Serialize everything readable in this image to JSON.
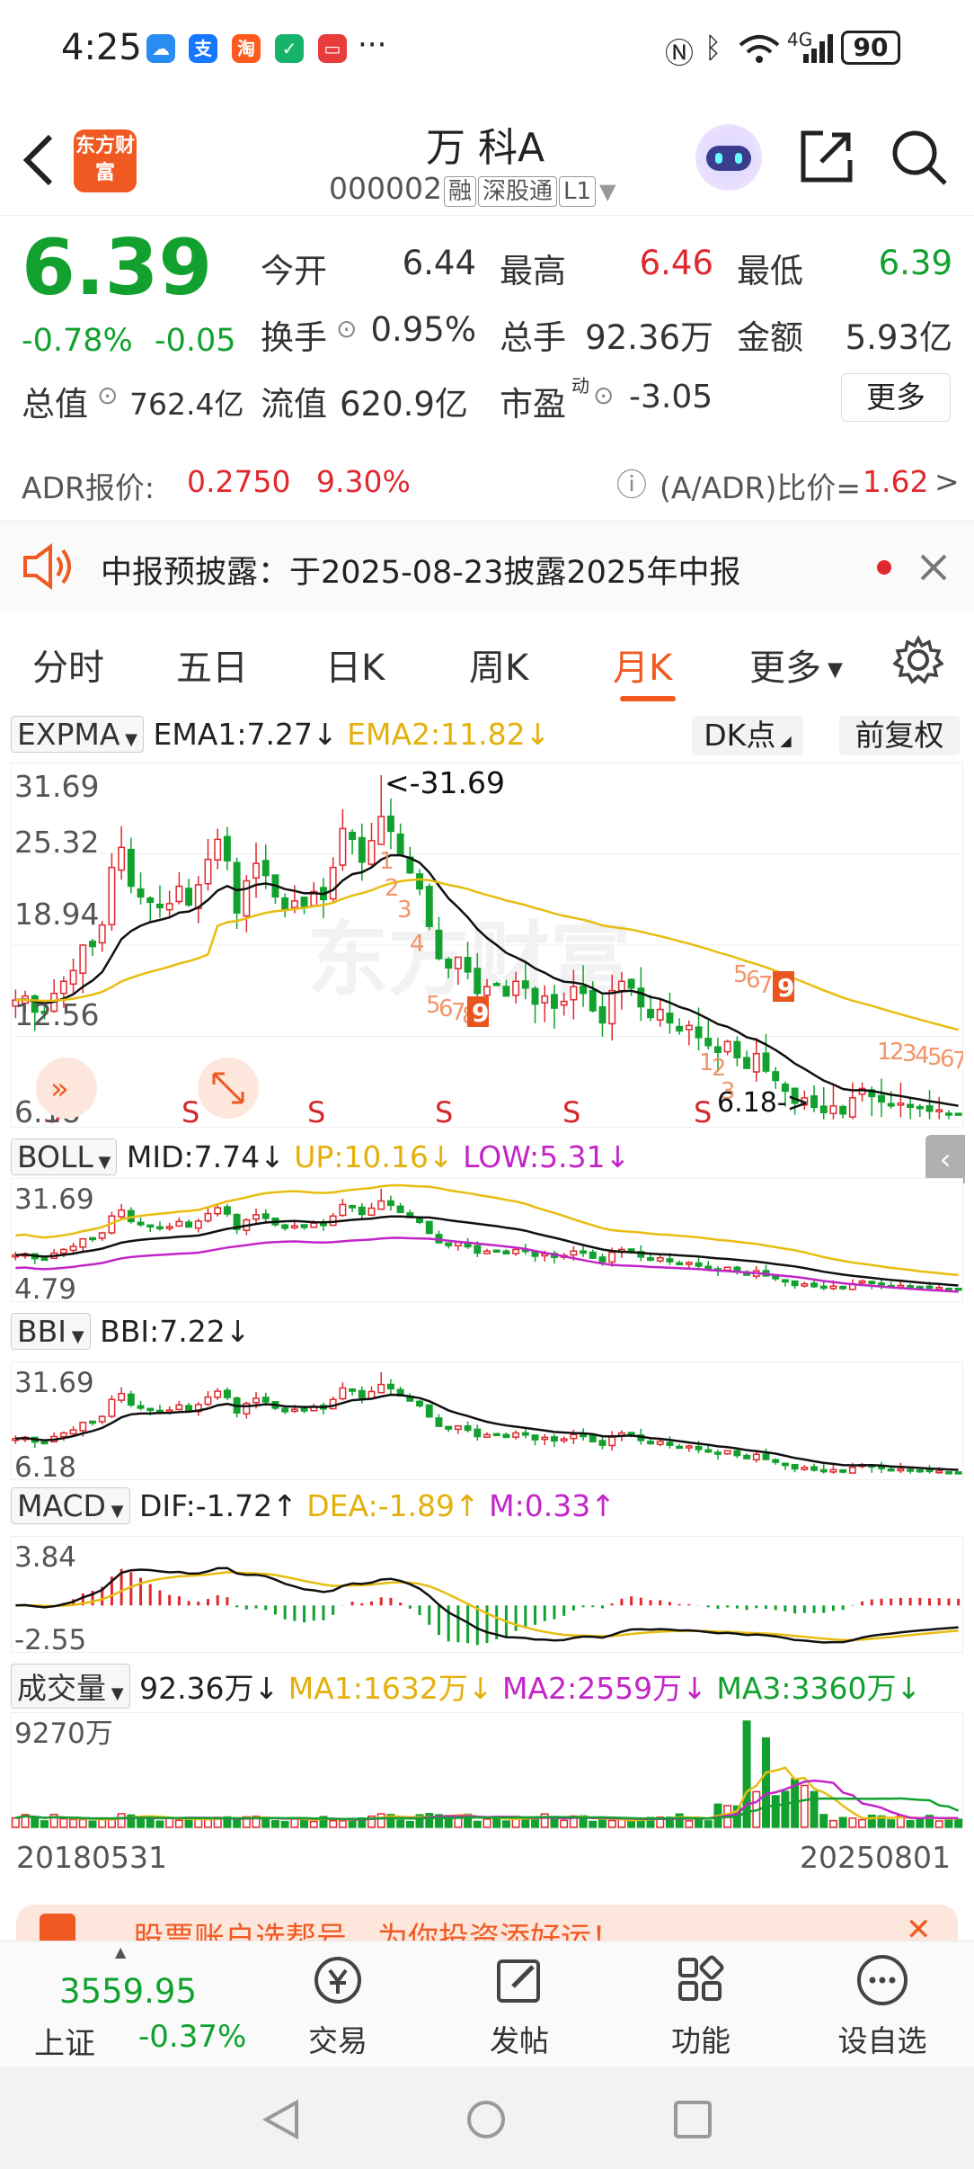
{
  "status": {
    "time": "4:25",
    "battery": "90",
    "network": "4G"
  },
  "header": {
    "title": "万 科A",
    "code": "000002",
    "tags": [
      "融",
      "深股通",
      "L1"
    ],
    "logo": "东方财富"
  },
  "quote": {
    "price": "6.39",
    "change_pct": "-0.78%",
    "change": "-0.05",
    "labels": {
      "open": "今开",
      "high": "最高",
      "low": "最低",
      "turnover": "换手",
      "volume": "总手",
      "amount": "金额",
      "mcap": "总值",
      "float": "流值",
      "pe": "市盈",
      "pe_sup": "动",
      "more": "更多"
    },
    "values": {
      "open": "6.44",
      "high": "6.46",
      "low": "6.39",
      "turnover": "0.95%",
      "volume": "92.36万",
      "amount": "5.93亿",
      "mcap": "762.4亿",
      "float": "620.9亿",
      "pe": "-3.05"
    }
  },
  "adr": {
    "label": "ADR报价:",
    "price": "0.2750",
    "pct": "9.30%",
    "ratio_label": "(A/ADR)比价=",
    "ratio": "1.62",
    "arrow": ">"
  },
  "notice": {
    "text": "中报预披露：于2025-08-23披露2025年中报"
  },
  "tabs": [
    "分时",
    "五日",
    "日K",
    "周K",
    "月K",
    "更多"
  ],
  "active_tab": "月K",
  "kline": {
    "indicator": "EXPMA",
    "ema1": "EMA1:7.27",
    "ema2": "EMA2:11.82",
    "dk_button": "DK点",
    "adjust_button": "前复权",
    "y_labels": [
      "31.69",
      "25.32",
      "18.94",
      "12.56",
      "6.18"
    ],
    "max_label": "<-31.69",
    "min_label": "6.18->",
    "watermark": "东方财富"
  },
  "boll": {
    "indicator": "BOLL",
    "mid": "MID:7.74",
    "up": "UP:10.16",
    "low": "LOW:5.31",
    "y_labels": [
      "31.69",
      "4.79"
    ]
  },
  "bbi": {
    "indicator": "BBI",
    "value": "BBI:7.22",
    "y_labels": [
      "31.69",
      "6.18"
    ]
  },
  "macd": {
    "indicator": "MACD",
    "dif": "DIF:-1.72",
    "dea": "DEA:-1.89",
    "m": "M:0.33",
    "y_labels": [
      "3.84",
      "-2.55"
    ]
  },
  "volume": {
    "indicator": "成交量",
    "value": "92.36万",
    "ma1": "MA1:1632万",
    "ma2": "MA2:2559万",
    "ma3": "MA3:3360万",
    "y_label": "9270万"
  },
  "dates": {
    "start": "20180531",
    "end": "20250801"
  },
  "banner": {
    "text": "股票账户选帮号，为你投资添好运！"
  },
  "bottom": {
    "index_value": "3559.95",
    "index_name": "上证",
    "index_change": "-0.37%",
    "items": [
      "交易",
      "发帖",
      "功能",
      "设自选"
    ]
  },
  "chart_data": {
    "type": "candlestick",
    "x_range": [
      "20180531",
      "20250801"
    ],
    "ylim": [
      6.18,
      31.69
    ],
    "price_series": [
      14.9,
      15.2,
      14.0,
      13.9,
      15.4,
      16.3,
      17.1,
      19.0,
      18.9,
      20.5,
      24.8,
      26.3,
      23.4,
      22.6,
      22.2,
      21.8,
      22.1,
      23.4,
      22.0,
      23.5,
      25.4,
      26.9,
      25.3,
      21.4,
      23.8,
      25.1,
      24.2,
      22.6,
      21.7,
      22.3,
      21.9,
      23.0,
      22.4,
      24.8,
      27.7,
      26.9,
      25.2,
      26.8,
      28.6,
      27.5,
      25.7,
      24.4,
      23.2,
      20.4,
      18.0,
      17.3,
      18.1,
      17.0,
      15.4,
      15.9,
      16.1,
      15.2,
      16.3,
      15.8,
      14.6,
      15.2,
      14.3,
      14.8,
      15.9,
      15.4,
      14.1,
      13.2,
      15.6,
      16.3,
      15.8,
      14.4,
      13.6,
      14.2,
      13.2,
      12.6,
      13.0,
      12.1,
      11.5,
      11.0,
      11.8,
      10.6,
      9.8,
      10.9,
      9.6,
      8.9,
      8.1,
      7.2,
      7.6,
      6.9,
      6.5,
      7.0,
      6.4,
      7.6,
      8.3,
      7.7,
      7.3,
      7.0,
      7.2,
      6.9,
      6.8,
      6.6,
      6.7,
      6.4,
      6.39
    ],
    "ema1_last": 7.27,
    "ema2_last": 11.82
  }
}
